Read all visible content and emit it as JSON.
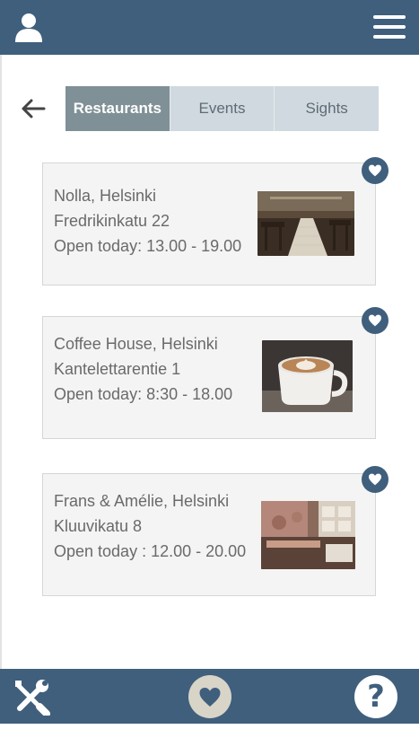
{
  "header": {
    "user_icon": "user-icon",
    "menu_icon": "hamburger-menu-icon",
    "background": "#3f5f7d"
  },
  "nav": {
    "back_icon": "arrow-left-icon",
    "tabs": [
      {
        "label": "Restaurants",
        "active": true
      },
      {
        "label": "Events",
        "active": false
      },
      {
        "label": "Sights",
        "active": false
      }
    ]
  },
  "places": [
    {
      "name": "Nolla, Helsinki",
      "address": "Fredrikinkatu 22",
      "hours": "Open today: 13.00 - 19.00",
      "image": "restaurant-interior-photo"
    },
    {
      "name": "Coffee House, Helsinki",
      "address": "Kantelettarentie 1",
      "hours": "Open today: 8:30 - 18.00",
      "image": "latte-art-coffee-photo"
    },
    {
      "name": "Frans & Amélie, Helsinki",
      "address": "Kluuvikatu 8",
      "hours": "Open today : 12.00 - 20.00",
      "image": "cafe-counter-photo"
    }
  ],
  "footer": {
    "tools_icon": "wrench-screwdriver-icon",
    "favorites_icon": "heart-icon",
    "help_label": "?",
    "accent": "#d8d4c8"
  }
}
